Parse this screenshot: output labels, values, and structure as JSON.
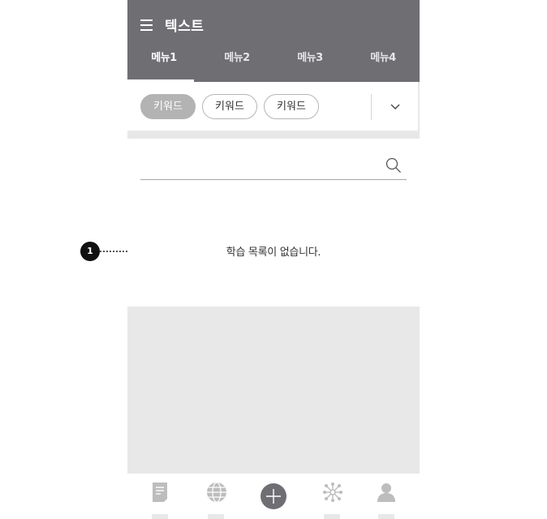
{
  "header": {
    "title": "텍스트",
    "background_color": "#6f6e73"
  },
  "tabs": [
    {
      "label": "메뉴1",
      "active": true
    },
    {
      "label": "메뉴2",
      "active": false
    },
    {
      "label": "메뉴3",
      "active": false
    },
    {
      "label": "메뉴4",
      "active": false
    }
  ],
  "keywords": [
    {
      "label": "키워드",
      "selected": true
    },
    {
      "label": "키워드",
      "selected": false
    },
    {
      "label": "키워드",
      "selected": false
    }
  ],
  "search": {
    "value": "",
    "placeholder": ""
  },
  "empty_state": {
    "message": "학습 목록이 없습니다."
  },
  "annotation": {
    "number": "1"
  },
  "bottom_nav": [
    {
      "icon": "document-icon"
    },
    {
      "icon": "globe-icon"
    },
    {
      "icon": "plus-circle-icon"
    },
    {
      "icon": "network-icon"
    },
    {
      "icon": "person-icon"
    }
  ],
  "colors": {
    "accent_gray": "#6f6e73",
    "chip_selected": "#b3b3b3",
    "placeholder_gray": "#e8e8e8"
  }
}
